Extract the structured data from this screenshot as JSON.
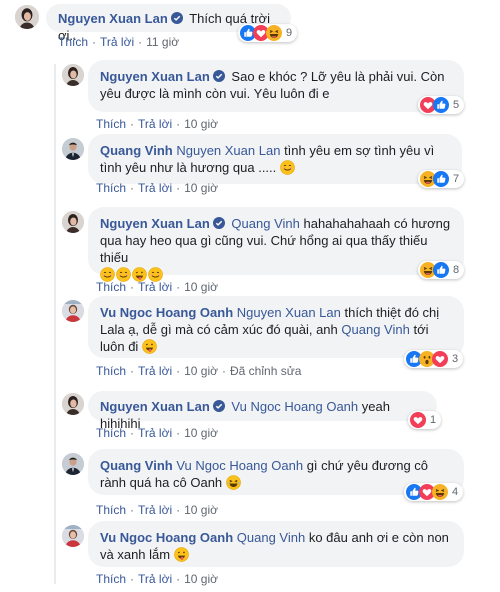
{
  "actions": {
    "like": "Thích",
    "reply": "Trả lời",
    "edited": "Đã chỉnh sửa"
  },
  "comments": [
    {
      "name": "Nguyen Xuan Lan",
      "verified": true,
      "text": "Thích quá trời ơi..",
      "time": "11 giờ",
      "reactions": {
        "icons": [
          "like-icon",
          "heart-icon",
          "haha-icon"
        ],
        "count": "9"
      }
    },
    {
      "name": "Nguyen Xuan Lan",
      "verified": true,
      "text": "Sao e khóc ? Lỡ yêu là phải vui. Còn yêu được là mình còn vui. Yêu luôn đi e",
      "time": "10 giờ",
      "reactions": {
        "icons": [
          "heart-icon",
          "like-icon"
        ],
        "count": "5"
      }
    },
    {
      "name": "Quang Vinh",
      "tag": "Nguyen Xuan Lan",
      "text": "tình yêu em sợ tình yêu vì tình yêu như là hương qua .....",
      "time": "10 giờ",
      "reactions": {
        "icons": [
          "haha-icon",
          "like-icon"
        ],
        "count": "7"
      }
    },
    {
      "name": "Nguyen Xuan Lan",
      "verified": true,
      "tag": "Quang Vinh",
      "text": "hahahahahaah có hương qua hay heo qua gì cũng vui. Chứ hổng ai qua thấy thiếu thiếu",
      "time": "10 giờ",
      "reactions": {
        "icons": [
          "haha-icon",
          "like-icon"
        ],
        "count": "8"
      }
    },
    {
      "name": "Vu Ngoc Hoang Oanh",
      "tag": "Nguyen Xuan Lan",
      "text": "thích thiệt đó chị Lala ạ, dễ gì mà có cảm xúc đó quài, anh",
      "tag2": "Quang Vinh",
      "text2": "tới luôn đi",
      "time": "10 giờ",
      "reactions": {
        "icons": [
          "like-icon",
          "wow-icon",
          "heart-icon"
        ],
        "count": "3"
      }
    },
    {
      "name": "Nguyen Xuan Lan",
      "verified": true,
      "tag": "Vu Ngoc Hoang Oanh",
      "text": "yeah hihihihi",
      "time": "10 giờ",
      "reactions": {
        "icons": [
          "heart-icon"
        ],
        "count": "1"
      }
    },
    {
      "name": "Quang Vinh",
      "tag": "Vu Ngoc Hoang Oanh",
      "text": "gì chứ yêu đương cô rành quá ha cô Oanh",
      "time": "10 giờ",
      "reactions": {
        "icons": [
          "like-icon",
          "heart-icon",
          "haha-icon"
        ],
        "count": "4"
      }
    },
    {
      "name": "Vu Ngoc Hoang Oanh",
      "tag": "Quang Vinh",
      "text": "ko đâu anh ơi e còn non và xanh lắm",
      "time": "10 giờ"
    }
  ],
  "colors": {
    "link": "#385898",
    "bubble": "#f2f3f5",
    "meta": "#606770",
    "like": "#1877f2",
    "heart": "#f33e58",
    "haha": "#f7b125"
  }
}
